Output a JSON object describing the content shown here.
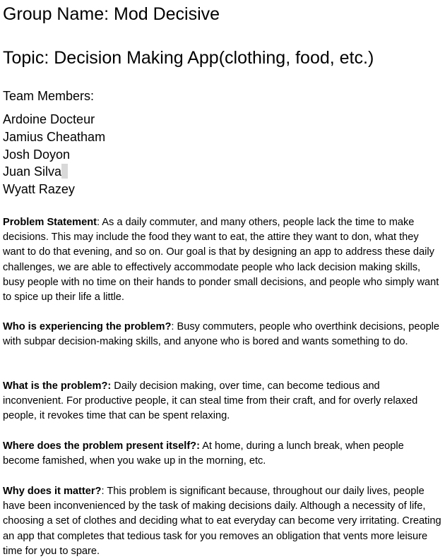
{
  "document": {
    "group_name": "Group Name: Mod Decisive",
    "topic": "Topic: Decision Making App(clothing, food, etc.)",
    "team_members_label": "Team Members:",
    "team_members": [
      "Ardoine Docteur",
      "Jamius Cheatham",
      "Josh Doyon",
      "Juan Silva",
      "Wyatt Razey"
    ],
    "sections": [
      {
        "label": "Problem Statement",
        "text": ": As a daily commuter, and many others, people lack the time to make decisions. This may include the food they want to eat, the attire they want to don, what they want to do that evening, and so on. Our goal is that by designing an app to address these daily challenges, we are able to effectively accommodate people who lack decision making skills, busy people with no time on their hands to ponder small decisions, and people who simply want to spice up their life a little."
      },
      {
        "label": "Who is experiencing the problem?",
        "text": ": Busy commuters, people who overthink decisions, people with subpar decision-making skills, and anyone who is bored and wants something to do."
      },
      {
        "label": "What is the problem?:",
        "text": " Daily decision making, over time, can become tedious and inconvenient. For productive people, it can steal time from their craft, and for overly relaxed people, it revokes time that can be spent relaxing."
      },
      {
        "label": "Where does the problem present itself?:",
        "text": " At home, during a lunch break, when people become famished, when you wake up in the morning, etc."
      },
      {
        "label": "Why does it matter?",
        "text": ": This problem is significant because, throughout our daily lives, people have been inconvenienced by the task of making decisions daily. Although a necessity of life, choosing a set of clothes and deciding what to eat everyday can become very irritating. Creating an app that completes that tedious task for you removes an obligation that vents more leisure time for you to spare."
      }
    ]
  }
}
